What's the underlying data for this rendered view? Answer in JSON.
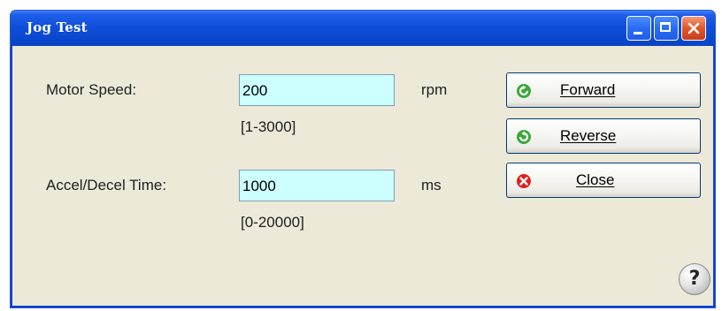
{
  "window": {
    "title": "Jog Test"
  },
  "fields": {
    "motor_speed": {
      "label": "Motor Speed:",
      "value": "200",
      "unit": "rpm",
      "range": "[1-3000]"
    },
    "accel_decel": {
      "label": "Accel/Decel Time:",
      "value": "1000",
      "unit": "ms",
      "range": "[0-20000]"
    }
  },
  "buttons": {
    "forward": "Forward",
    "reverse": "Reverse",
    "close": "Close"
  },
  "help": {
    "symbol": "?"
  },
  "colors": {
    "titlebar": "#0a47cf",
    "field_bg": "#ccffff",
    "window_bg": "#ece9d8"
  },
  "icons": {
    "forward": "arrow-forward-icon",
    "reverse": "arrow-reverse-icon",
    "close": "close-x-icon",
    "help": "help-icon"
  }
}
